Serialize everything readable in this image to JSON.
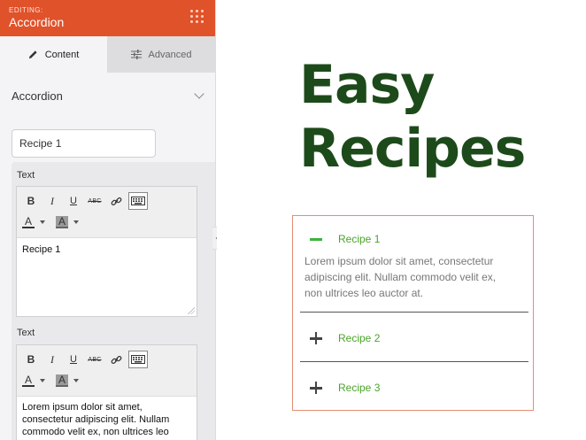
{
  "header": {
    "editing_label": "EDITING:",
    "title": "Accordion"
  },
  "tabs": [
    {
      "label": "Content",
      "icon": "pencil-icon",
      "active": true
    },
    {
      "label": "Advanced",
      "icon": "sliders-icon",
      "active": false
    }
  ],
  "section": {
    "title": "Accordion"
  },
  "item": {
    "title_value": "Recipe 1",
    "fields": [
      {
        "label": "Text",
        "content": "Recipe 1"
      },
      {
        "label": "Text",
        "content": "Lorem ipsum dolor sit amet, consectetur adipiscing elit. Nullam commodo velit ex, non ultrices leo"
      }
    ]
  },
  "toolbar": {
    "bold": "B",
    "italic": "I",
    "underline": "U",
    "strike": "ABC",
    "font_color": "A",
    "bg_color": "A"
  },
  "preview": {
    "heading_line1": "Easy",
    "heading_line2": "Recipes",
    "accordion": [
      {
        "title": "Recipe 1",
        "expanded": true,
        "body": "Lorem ipsum dolor sit amet, consectetur adipiscing elit. Nullam commodo velit ex, non ultrices leo auctor at."
      },
      {
        "title": "Recipe 2",
        "expanded": false
      },
      {
        "title": "Recipe 3",
        "expanded": false
      }
    ]
  },
  "colors": {
    "header_bg": "#e0522a",
    "heading": "#1d4a1a",
    "accordion_title": "#4aa528",
    "accordion_border": "#e58e74"
  }
}
